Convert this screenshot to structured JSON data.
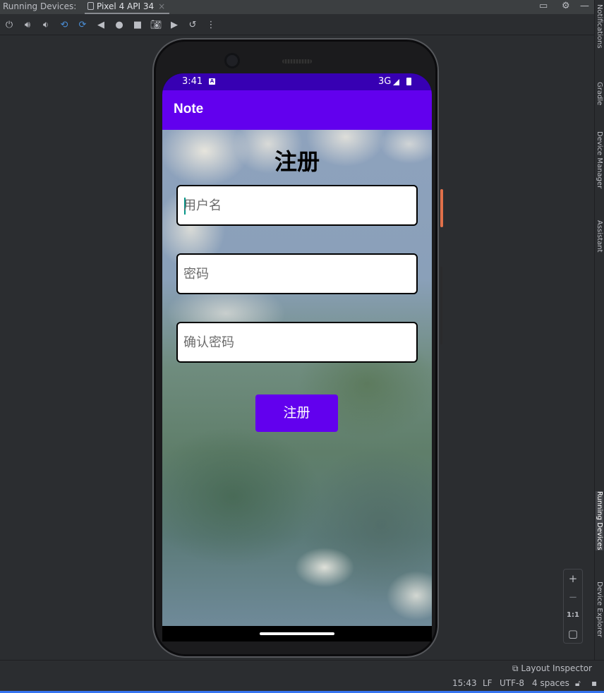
{
  "ide": {
    "panel_title": "Running Devices:",
    "device_tab": "Pixel 4 API 34",
    "tab_close": "×",
    "right_stripe": [
      "Notifications",
      "Gradle",
      "Device Manager",
      "Assistant",
      "Running Devices",
      "Device Explorer"
    ],
    "zoom": {
      "plus": "+",
      "minus": "−",
      "one_to_one": "1:1"
    },
    "layout_inspector": "Layout Inspector",
    "status": {
      "time": "15:43",
      "line_sep": "LF",
      "encoding": "UTF-8",
      "indent": "4 spaces"
    }
  },
  "device": {
    "status_bar": {
      "time": "3:41",
      "network": "3G"
    },
    "app_title": "Note",
    "page_title": "注册",
    "fields": {
      "username_placeholder": "用户名",
      "password_placeholder": "密码",
      "confirm_placeholder": "确认密码"
    },
    "register_button": "注册"
  },
  "colors": {
    "primary": "#6200ee",
    "status_bar": "#3700b3",
    "accent": "#e0704a"
  }
}
